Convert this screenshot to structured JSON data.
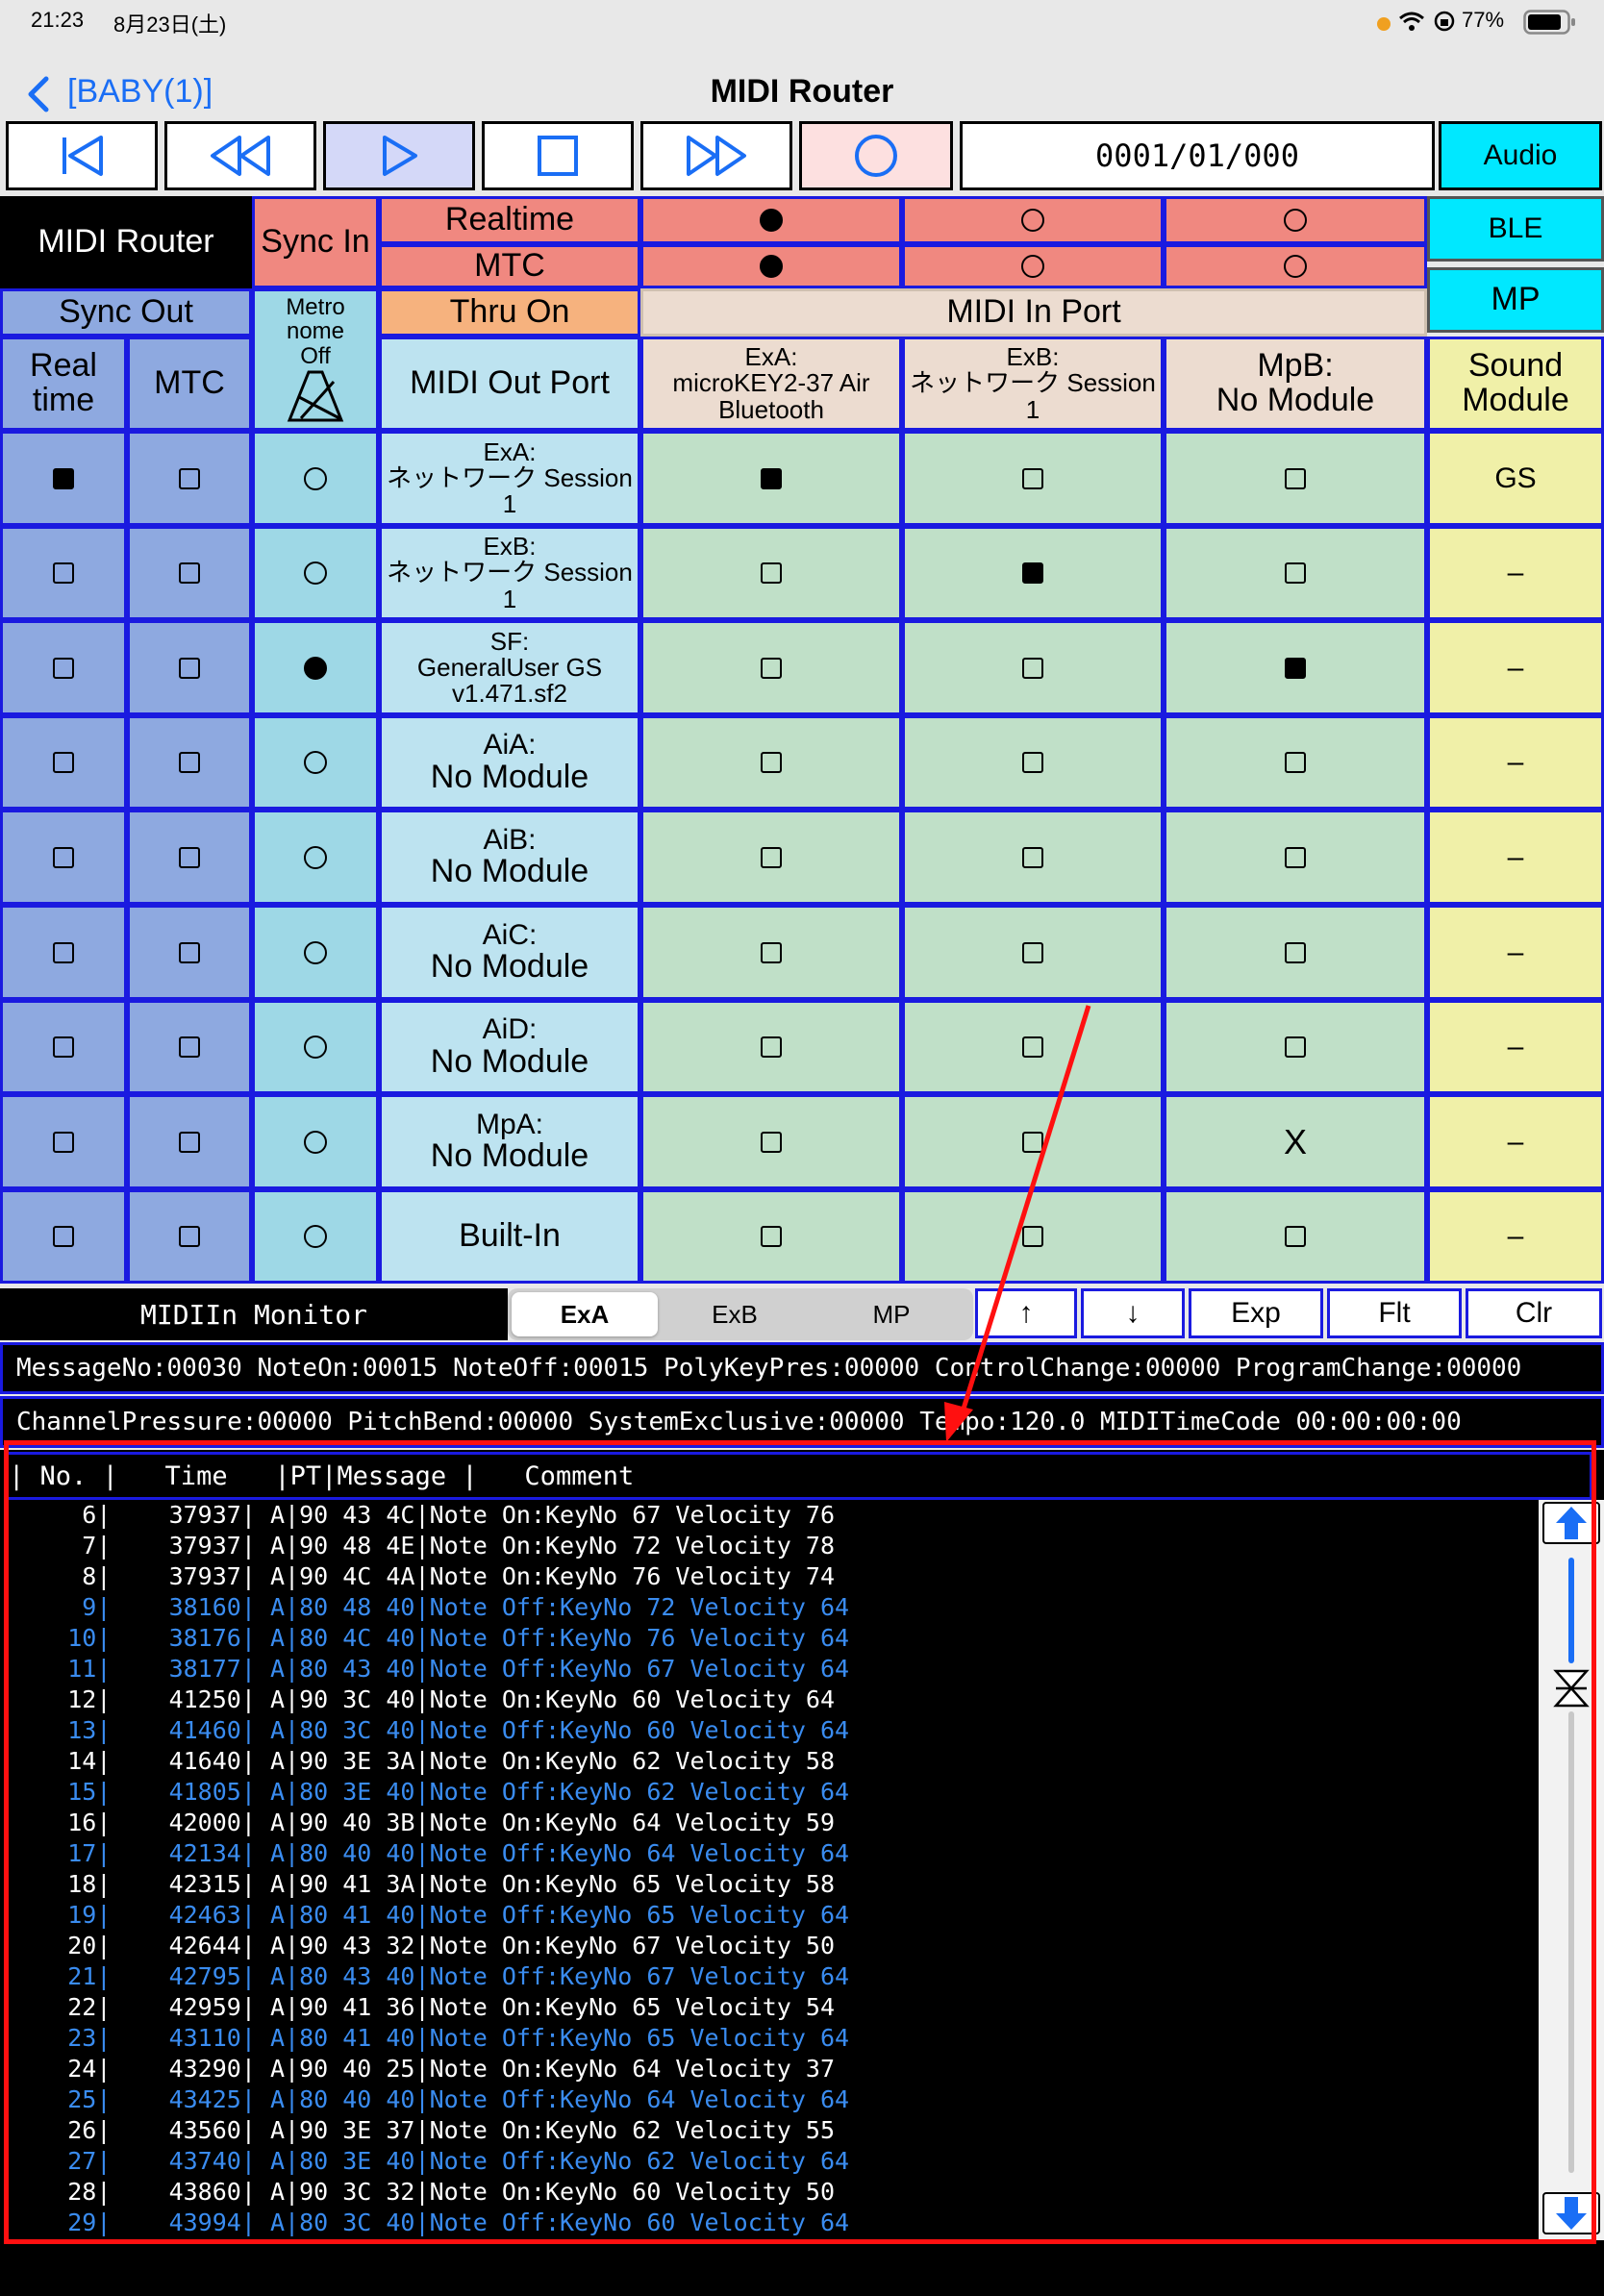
{
  "status": {
    "time": "21:23",
    "date": "8月23日(土)",
    "battery": "77%"
  },
  "nav": {
    "back_label": "[BABY(1)]",
    "title": "MIDI Router"
  },
  "transport": {
    "counter": "0001/01/000",
    "audio_label": "Audio"
  },
  "side": {
    "ble": "BLE",
    "mp": "MP"
  },
  "header": {
    "midi_router": "MIDI Router",
    "sync_in": "Sync In",
    "realtime": "Realtime",
    "mtc": "MTC",
    "sync_out": "Sync Out",
    "metronome": [
      "Metro",
      "nome",
      "Off"
    ],
    "thru_on": "Thru On",
    "midi_in_port": "MIDI In Port",
    "col_realtime": [
      "Real",
      "time"
    ],
    "col_mtc": "MTC",
    "midi_out_port": "MIDI Out Port",
    "sound_module": [
      "Sound",
      "Module"
    ]
  },
  "sync_in_rows": [
    {
      "label": "Realtime",
      "states": [
        true,
        false,
        false
      ]
    },
    {
      "label": "MTC",
      "states": [
        true,
        false,
        false
      ]
    }
  ],
  "in_ports": [
    [
      "ExA:",
      "microKEY2-37 Air",
      "Bluetooth"
    ],
    [
      "ExB:",
      "ネットワーク Session",
      "1"
    ],
    [
      "MpB:",
      "No Module"
    ]
  ],
  "rows": [
    {
      "out": [
        "ExA:",
        "ネットワーク Session",
        "1"
      ],
      "rt": true,
      "mtc": false,
      "metro": false,
      "cells": [
        "on",
        "off",
        "off"
      ],
      "module": "GS"
    },
    {
      "out": [
        "ExB:",
        "ネットワーク Session",
        "1"
      ],
      "rt": false,
      "mtc": false,
      "metro": false,
      "cells": [
        "off",
        "on",
        "off"
      ],
      "module": "–"
    },
    {
      "out": [
        "SF:",
        "GeneralUser GS",
        "v1.471.sf2"
      ],
      "rt": false,
      "mtc": false,
      "metro": true,
      "cells": [
        "off",
        "off",
        "on"
      ],
      "module": "–"
    },
    {
      "out": [
        "AiA:",
        "No Module"
      ],
      "rt": false,
      "mtc": false,
      "metro": false,
      "cells": [
        "off",
        "off",
        "off"
      ],
      "module": "–"
    },
    {
      "out": [
        "AiB:",
        "No Module"
      ],
      "rt": false,
      "mtc": false,
      "metro": false,
      "cells": [
        "off",
        "off",
        "off"
      ],
      "module": "–"
    },
    {
      "out": [
        "AiC:",
        "No Module"
      ],
      "rt": false,
      "mtc": false,
      "metro": false,
      "cells": [
        "off",
        "off",
        "off"
      ],
      "module": "–"
    },
    {
      "out": [
        "AiD:",
        "No Module"
      ],
      "rt": false,
      "mtc": false,
      "metro": false,
      "cells": [
        "off",
        "off",
        "off"
      ],
      "module": "–"
    },
    {
      "out": [
        "MpA:",
        "No Module"
      ],
      "rt": false,
      "mtc": false,
      "metro": false,
      "cells": [
        "off",
        "off",
        "X"
      ],
      "module": "–"
    },
    {
      "out": [
        "Built-In"
      ],
      "rt": false,
      "mtc": false,
      "metro": false,
      "cells": [
        "off",
        "off",
        "off"
      ],
      "module": "–"
    }
  ],
  "monitor": {
    "title": "MIDIIn Monitor",
    "tabs": [
      "ExA",
      "ExB",
      "MP"
    ],
    "selected_tab": "ExA",
    "buttons": [
      "↑",
      "↓",
      "Exp",
      "Flt",
      "Clr"
    ],
    "stats_line1": "MessageNo:00030 NoteOn:00015 NoteOff:00015 PolyKeyPres:00000 ControlChange:00000 ProgramChange:00000",
    "stats_line2": "ChannelPressure:00000 PitchBend:00000 SystemExclusive:00000 Tempo:120.0 MIDITimeCode 00:00:00:00",
    "log_header": "| No. |   Time   |PT|Message |   Comment",
    "note_on_color": "#ffffff",
    "note_off_color": "#3a8cf0",
    "log": [
      {
        "no": "6",
        "time": "37937",
        "pt": "A",
        "msg": "90 43 4C",
        "comment": "Note On:KeyNo 67 Velocity 76"
      },
      {
        "no": "7",
        "time": "37937",
        "pt": "A",
        "msg": "90 48 4E",
        "comment": "Note On:KeyNo 72 Velocity 78"
      },
      {
        "no": "8",
        "time": "37937",
        "pt": "A",
        "msg": "90 4C 4A",
        "comment": "Note On:KeyNo 76 Velocity 74"
      },
      {
        "no": "9",
        "time": "38160",
        "pt": "A",
        "msg": "80 48 40",
        "comment": "Note Off:KeyNo 72 Velocity 64"
      },
      {
        "no": "10",
        "time": "38176",
        "pt": "A",
        "msg": "80 4C 40",
        "comment": "Note Off:KeyNo 76 Velocity 64"
      },
      {
        "no": "11",
        "time": "38177",
        "pt": "A",
        "msg": "80 43 40",
        "comment": "Note Off:KeyNo 67 Velocity 64"
      },
      {
        "no": "12",
        "time": "41250",
        "pt": "A",
        "msg": "90 3C 40",
        "comment": "Note On:KeyNo 60 Velocity 64"
      },
      {
        "no": "13",
        "time": "41460",
        "pt": "A",
        "msg": "80 3C 40",
        "comment": "Note Off:KeyNo 60 Velocity 64"
      },
      {
        "no": "14",
        "time": "41640",
        "pt": "A",
        "msg": "90 3E 3A",
        "comment": "Note On:KeyNo 62 Velocity 58"
      },
      {
        "no": "15",
        "time": "41805",
        "pt": "A",
        "msg": "80 3E 40",
        "comment": "Note Off:KeyNo 62 Velocity 64"
      },
      {
        "no": "16",
        "time": "42000",
        "pt": "A",
        "msg": "90 40 3B",
        "comment": "Note On:KeyNo 64 Velocity 59"
      },
      {
        "no": "17",
        "time": "42134",
        "pt": "A",
        "msg": "80 40 40",
        "comment": "Note Off:KeyNo 64 Velocity 64"
      },
      {
        "no": "18",
        "time": "42315",
        "pt": "A",
        "msg": "90 41 3A",
        "comment": "Note On:KeyNo 65 Velocity 58"
      },
      {
        "no": "19",
        "time": "42463",
        "pt": "A",
        "msg": "80 41 40",
        "comment": "Note Off:KeyNo 65 Velocity 64"
      },
      {
        "no": "20",
        "time": "42644",
        "pt": "A",
        "msg": "90 43 32",
        "comment": "Note On:KeyNo 67 Velocity 50"
      },
      {
        "no": "21",
        "time": "42795",
        "pt": "A",
        "msg": "80 43 40",
        "comment": "Note Off:KeyNo 67 Velocity 64"
      },
      {
        "no": "22",
        "time": "42959",
        "pt": "A",
        "msg": "90 41 36",
        "comment": "Note On:KeyNo 65 Velocity 54"
      },
      {
        "no": "23",
        "time": "43110",
        "pt": "A",
        "msg": "80 41 40",
        "comment": "Note Off:KeyNo 65 Velocity 64"
      },
      {
        "no": "24",
        "time": "43290",
        "pt": "A",
        "msg": "90 40 25",
        "comment": "Note On:KeyNo 64 Velocity 37"
      },
      {
        "no": "25",
        "time": "43425",
        "pt": "A",
        "msg": "80 40 40",
        "comment": "Note Off:KeyNo 64 Velocity 64"
      },
      {
        "no": "26",
        "time": "43560",
        "pt": "A",
        "msg": "90 3E 37",
        "comment": "Note On:KeyNo 62 Velocity 55"
      },
      {
        "no": "27",
        "time": "43740",
        "pt": "A",
        "msg": "80 3E 40",
        "comment": "Note Off:KeyNo 62 Velocity 64"
      },
      {
        "no": "28",
        "time": "43860",
        "pt": "A",
        "msg": "90 3C 32",
        "comment": "Note On:KeyNo 60 Velocity 50"
      },
      {
        "no": "29",
        "time": "43994",
        "pt": "A",
        "msg": "80 3C 40",
        "comment": "Note Off:KeyNo 60 Velocity 64"
      }
    ]
  }
}
